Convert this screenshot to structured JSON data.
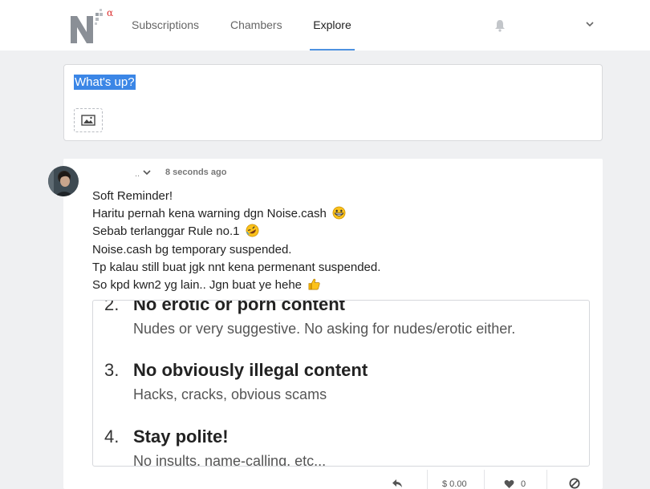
{
  "nav": {
    "tabs": [
      {
        "label": "Subscriptions",
        "active": false
      },
      {
        "label": "Chambers",
        "active": false
      },
      {
        "label": "Explore",
        "active": true
      }
    ],
    "logo_mark": "α"
  },
  "composer": {
    "placeholder": "What's up?",
    "image_button_icon": "image-icon"
  },
  "post": {
    "author_name_placeholder": "..",
    "timestamp": "8 seconds ago",
    "lines": [
      {
        "text": "Soft Reminder!",
        "emoji": null
      },
      {
        "text": "Haritu pernah kena warning dgn Noise.cash",
        "emoji": "grinning-face-emoji"
      },
      {
        "text": "Sebab terlanggar Rule no.1",
        "emoji": "rofl-emoji"
      },
      {
        "text": "Noise.cash bg temporary suspended.",
        "emoji": null
      },
      {
        "text": "Tp kalau still buat jgk nnt kena permenant suspended.",
        "emoji": null
      },
      {
        "text": "So kpd kwn2 yg lain.. Jgn buat ye hehe",
        "emoji": "thumbs-up-emoji"
      }
    ],
    "embedded_rules": [
      {
        "number": "2.",
        "title": "No erotic or porn content",
        "description": "Nudes or very suggestive. No asking for nudes/erotic either."
      },
      {
        "number": "3.",
        "title": "No obviously illegal content",
        "description": "Hacks, cracks, obvious scams"
      },
      {
        "number": "4.",
        "title": "Stay polite!",
        "description": "No insults, name-calling, etc..."
      }
    ],
    "actions": {
      "tip_amount": "$ 0.00",
      "like_count": "0"
    }
  },
  "colors": {
    "accent": "#4e92e0",
    "selection": "#3b86e6",
    "background": "#eff0f2"
  }
}
